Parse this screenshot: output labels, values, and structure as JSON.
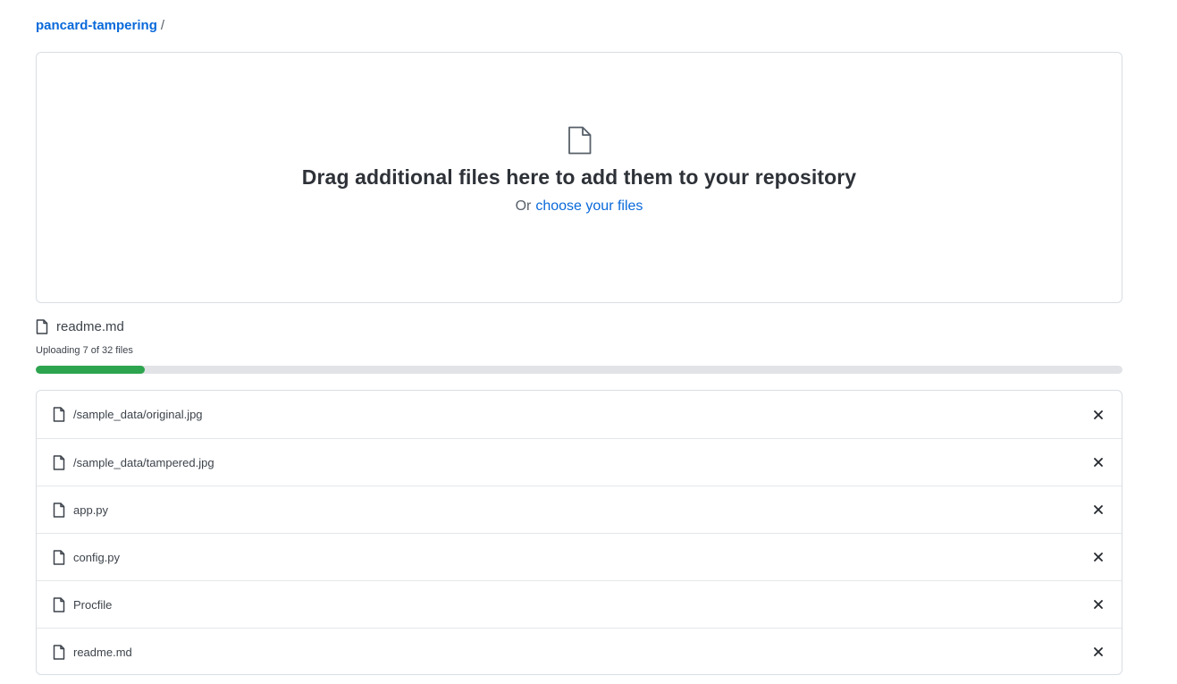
{
  "breadcrumb": {
    "repo": "pancard-tampering",
    "separator": "/"
  },
  "dropzone": {
    "icon": "file-icon",
    "headline": "Drag additional files here to add them to your repository",
    "prefix": "Or",
    "choose_link": "choose your files"
  },
  "upload": {
    "current_file": "readme.md",
    "status": "Uploading 7 of 32 files",
    "progress_fraction": 0.1,
    "progress_color": "#2da44e",
    "track_color": "#e1e3e6"
  },
  "files": [
    {
      "name": "/sample_data/original.jpg",
      "icon": "file-icon",
      "remove_icon": "close-icon"
    },
    {
      "name": "/sample_data/tampered.jpg",
      "icon": "file-icon",
      "remove_icon": "close-icon"
    },
    {
      "name": "app.py",
      "icon": "file-icon",
      "remove_icon": "close-icon"
    },
    {
      "name": "config.py",
      "icon": "file-icon",
      "remove_icon": "close-icon"
    },
    {
      "name": "Procfile",
      "icon": "file-icon",
      "remove_icon": "close-icon"
    },
    {
      "name": "readme.md",
      "icon": "file-icon",
      "remove_icon": "close-icon"
    }
  ],
  "colors": {
    "link": "#0969da",
    "border": "#d8dee4"
  }
}
